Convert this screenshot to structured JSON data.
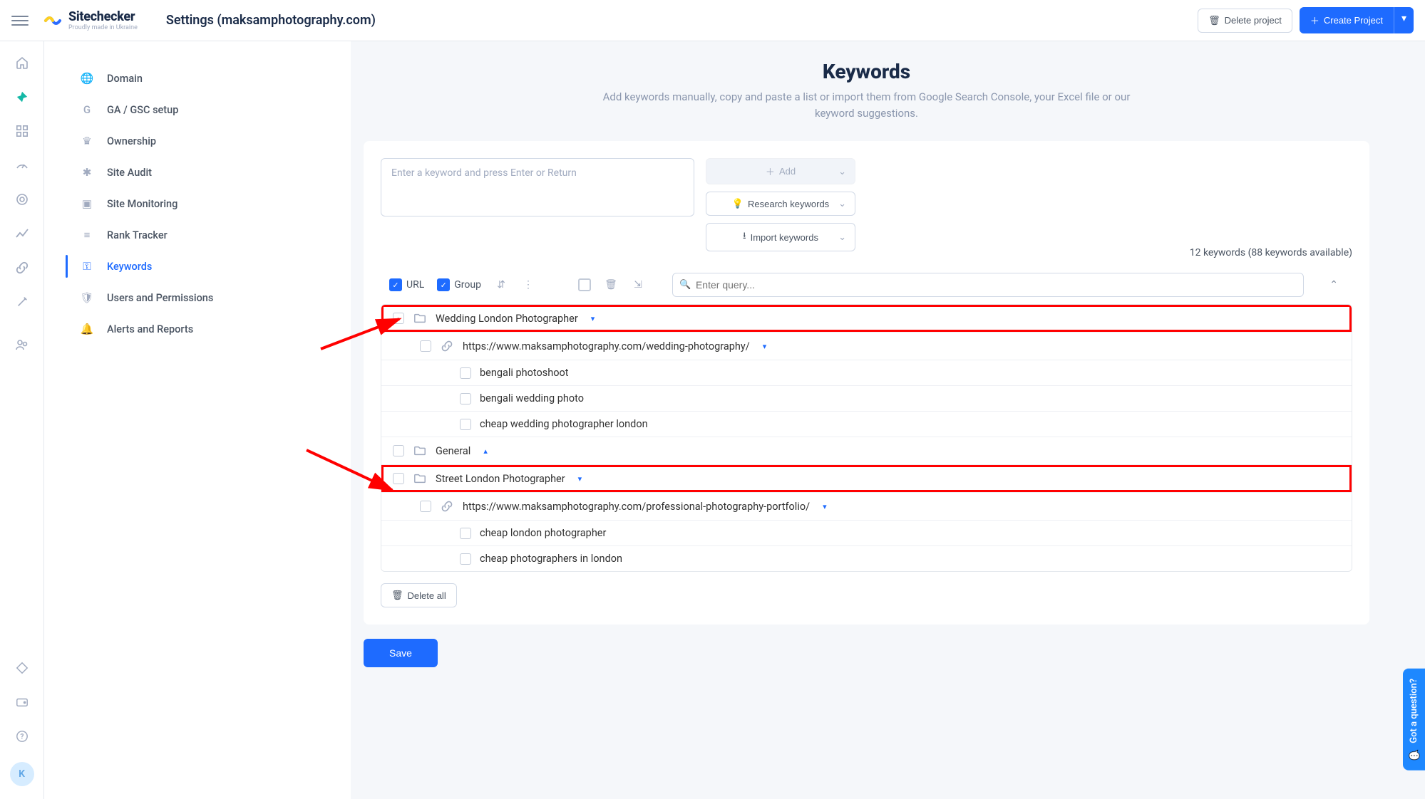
{
  "topbar": {
    "logo_title": "Sitechecker",
    "logo_tag": "Proudly made in Ukraine",
    "page_title": "Settings (maksamphotography.com)",
    "delete_project": "Delete project",
    "create_project": "Create Project"
  },
  "rail": {
    "avatar_letter": "K"
  },
  "settings_nav": [
    {
      "icon": "globe-icon",
      "glyph": "🌐",
      "label": "Domain",
      "active": false
    },
    {
      "icon": "google-icon",
      "glyph": "G",
      "label": "GA / GSC setup",
      "active": false
    },
    {
      "icon": "crown-icon",
      "glyph": "♛",
      "label": "Ownership",
      "active": false
    },
    {
      "icon": "bug-icon",
      "glyph": "✱",
      "label": "Site Audit",
      "active": false
    },
    {
      "icon": "monitor-icon",
      "glyph": "▣",
      "label": "Site Monitoring",
      "active": false
    },
    {
      "icon": "rank-icon",
      "glyph": "≡",
      "label": "Rank Tracker",
      "active": false
    },
    {
      "icon": "key-icon",
      "glyph": "⚿",
      "label": "Keywords",
      "active": true
    },
    {
      "icon": "shield-icon",
      "glyph": "🛡",
      "label": "Users and Permissions",
      "active": false
    },
    {
      "icon": "bell-icon",
      "glyph": "🔔",
      "label": "Alerts and Reports",
      "active": false
    }
  ],
  "main": {
    "title": "Keywords",
    "subtitle": "Add keywords manually, copy and paste a list or import them from Google Search Console, your Excel file or our keyword suggestions.",
    "input_placeholder": "Enter a keyword and press Enter or Return",
    "add_btn": "Add",
    "research_btn": "Research keywords",
    "import_btn": "Import keywords",
    "counter": "12 keywords (88 keywords available)",
    "url_label": "URL",
    "group_label": "Group",
    "search_placeholder": "Enter query...",
    "delete_all": "Delete all",
    "save": "Save"
  },
  "tree": [
    {
      "level": 0,
      "type": "folder",
      "label": "Wedding London Photographer",
      "caret": "down",
      "highlight": true
    },
    {
      "level": 1,
      "type": "url",
      "label": "https://www.maksamphotography.com/wedding-photography/",
      "caret": "down"
    },
    {
      "level": 2,
      "type": "kw",
      "label": "bengali photoshoot"
    },
    {
      "level": 2,
      "type": "kw",
      "label": "bengali wedding photo"
    },
    {
      "level": 2,
      "type": "kw",
      "label": "cheap wedding photographer london"
    },
    {
      "level": 0,
      "type": "folder",
      "label": "General",
      "caret": "up"
    },
    {
      "level": 0,
      "type": "folder",
      "label": "Street London Photographer",
      "caret": "down",
      "highlight": true
    },
    {
      "level": 1,
      "type": "url",
      "label": "https://www.maksamphotography.com/professional-photography-portfolio/",
      "caret": "down"
    },
    {
      "level": 2,
      "type": "kw",
      "label": "cheap london photographer"
    },
    {
      "level": 2,
      "type": "kw",
      "label": "cheap photographers in london"
    }
  ],
  "question_tab": "Got a question?"
}
